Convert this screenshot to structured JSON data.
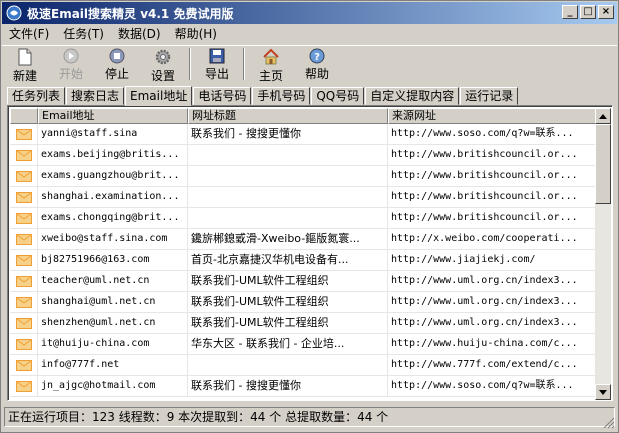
{
  "window": {
    "title": "极速Email搜索精灵 v4.1 免费试用版",
    "minimize": "_",
    "maximize": "□",
    "close": "×"
  },
  "menu": [
    "文件(F)",
    "任务(T)",
    "数据(D)",
    "帮助(H)"
  ],
  "toolbar": {
    "new": "新建",
    "start": "开始",
    "stop": "停止",
    "settings": "设置",
    "export": "导出",
    "home": "主页",
    "help": "帮助"
  },
  "tabs": [
    "任务列表",
    "搜索日志",
    "Email地址",
    "电话号码",
    "手机号码",
    "QQ号码",
    "自定义提取内容",
    "运行记录"
  ],
  "table": {
    "headers": [
      "",
      "Email地址",
      "网址标题",
      "来源网址"
    ],
    "rows": [
      [
        "yanni@staff.sina",
        "联系我们 - 搜搜更懂你",
        "http://www.soso.com/q?w=联系..."
      ],
      [
        "exams.beijing@britis...",
        "",
        "http://www.britishcouncil.or..."
      ],
      [
        "exams.guangzhou@brit...",
        "",
        "http://www.britishcouncil.or..."
      ],
      [
        "shanghai.examination...",
        "",
        "http://www.britishcouncil.or..."
      ],
      [
        "exams.chongqing@brit...",
        "",
        "http://www.britishcouncil.or..."
      ],
      [
        "xweibo@staff.sina.com",
        "鑱旂郴鎴戜滑-Xweibo-鏂版氮寰...",
        "http://x.weibo.com/cooperati..."
      ],
      [
        "bj82751966@163.com",
        "首页-北京嘉捷汉华机电设备有...",
        "http://www.jiajiekj.com/"
      ],
      [
        "teacher@uml.net.cn",
        "联系我们-UML软件工程组织",
        "http://www.uml.org.cn/index3..."
      ],
      [
        "shanghai@uml.net.cn",
        "联系我们-UML软件工程组织",
        "http://www.uml.org.cn/index3..."
      ],
      [
        "shenzhen@uml.net.cn",
        "联系我们-UML软件工程组织",
        "http://www.uml.org.cn/index3..."
      ],
      [
        "it@huiju-china.com",
        "华东大区 - 联系我们 - 企业培...",
        "http://www.huiju-china.com/c..."
      ],
      [
        "info@777f.net",
        "",
        "http://www.777f.com/extend/c..."
      ],
      [
        "jn_ajgc@hotmail.com",
        "联系我们 - 搜搜更懂你",
        "http://www.soso.com/q?w=联系..."
      ]
    ]
  },
  "status": {
    "text": "正在运行项目：123 线程数：9 本次提取到：44 个 总提取数量：44 个"
  },
  "colors": {
    "titlebar_start": "#0a246a",
    "titlebar_end": "#a6caf0",
    "face": "#d4d0c8",
    "envelope": "#f0a030"
  }
}
